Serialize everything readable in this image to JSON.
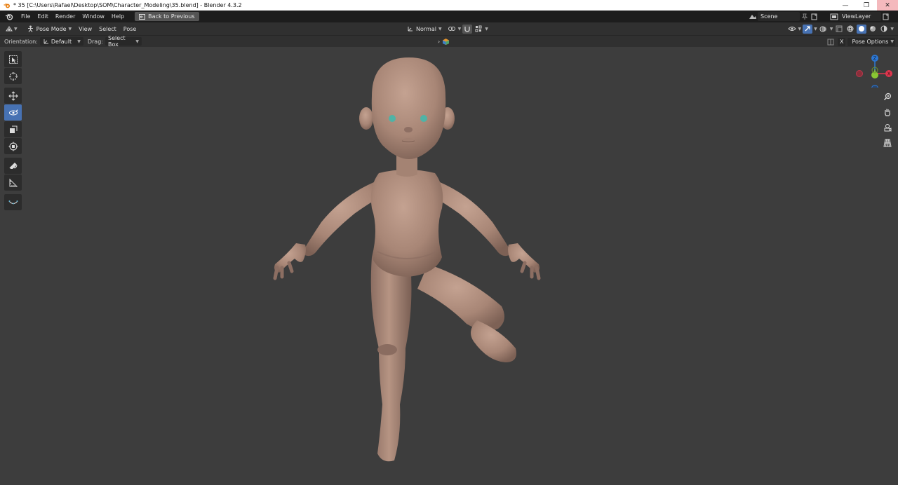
{
  "window": {
    "title": "* 35 [C:\\Users\\Rafael\\Desktop\\SOM\\Character_Modeling\\35.blend] - Blender 4.3.2",
    "controls": [
      "—",
      "❐",
      "✕"
    ]
  },
  "menubar": {
    "items": [
      "File",
      "Edit",
      "Render",
      "Window",
      "Help"
    ],
    "back_button": "Back to Previous",
    "scene": "Scene",
    "view_layer": "ViewLayer"
  },
  "header": {
    "mode": "Pose Mode",
    "menus": [
      "View",
      "Select",
      "Pose"
    ],
    "transform_orientation": "Normal"
  },
  "tool_options": {
    "orientation_label": "Orientation:",
    "orientation_value": "Default",
    "drag_label": "Drag:",
    "drag_value": "Select Box",
    "axis_x": "X",
    "pose_options": "Pose Options"
  },
  "gizmo": {
    "z_label": "Z",
    "x_label": "X",
    "colors": {
      "x": "#e0364e",
      "y": "#8ac733",
      "z": "#2d78d4"
    }
  },
  "colors": {
    "active_tool": "#4772b3",
    "skin": "#b08d7c",
    "eyes": "#4fb3a6"
  }
}
